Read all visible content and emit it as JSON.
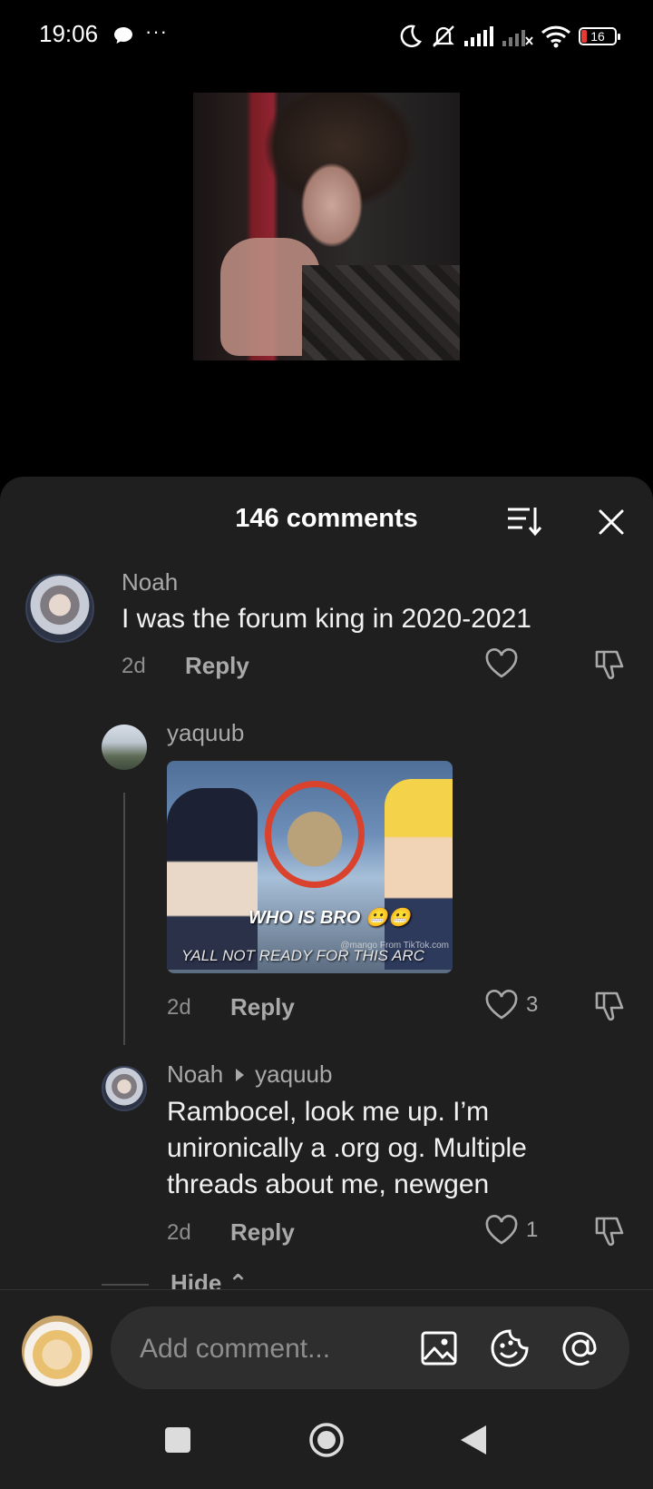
{
  "status_bar": {
    "time": "19:06",
    "more": "···",
    "battery": "16"
  },
  "sheet": {
    "title": "146 comments"
  },
  "comments": [
    {
      "username": "Noah",
      "text": "I was the forum king in 2020-2021",
      "time": "2d",
      "reply_label": "Reply",
      "likes": ""
    },
    {
      "username": "yaquub",
      "image_caption_top": "WHO IS BRO 😬😬",
      "image_caption_bottom": "YALL NOT READY FOR THIS ARC",
      "image_watermark": "@mango  From TikTok.com",
      "time": "2d",
      "reply_label": "Reply",
      "likes": "3"
    },
    {
      "username": "Noah",
      "reply_to": "yaquub",
      "text": "Rambocel, look me up. I’m unironically a .org og. Multiple threads about me, newgen",
      "time": "2d",
      "reply_label": "Reply",
      "likes": "1"
    }
  ],
  "hide": {
    "label": "Hide ⌃"
  },
  "composer": {
    "placeholder": "Add comment..."
  },
  "icons": [
    "chat-bubble-icon",
    "moon-icon",
    "mute-icon",
    "signal-icon",
    "wifi-icon",
    "battery-icon",
    "sort-icon",
    "close-icon",
    "heart-icon",
    "dislike-icon",
    "image-icon",
    "emoji-icon",
    "at-icon",
    "nav-square-icon",
    "nav-home-icon",
    "nav-back-icon"
  ],
  "colors": {
    "sheet_bg": "#1f1f1f",
    "pill_bg": "#2e2e2e",
    "muted_text": "#a9a9a9",
    "battery_low": "#e53935"
  }
}
